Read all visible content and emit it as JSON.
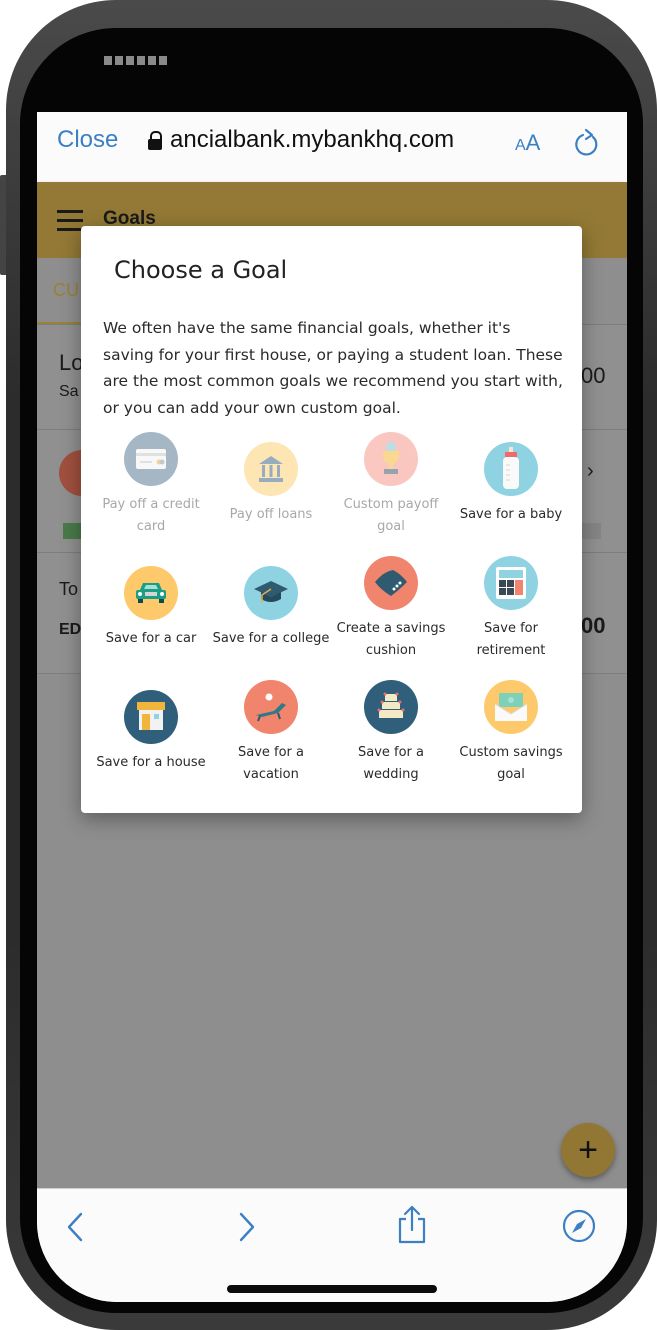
{
  "browser": {
    "close_label": "Close",
    "url": "ancialbank.mybankhq.com",
    "text_size_label": "AA"
  },
  "app_header": {
    "title": "Goals"
  },
  "background": {
    "tab_partial": "CU",
    "card1_title_partial": "Lo",
    "card1_sub_partial": "Sa",
    "card1_amount_partial": "00",
    "card3_title_partial": "To",
    "card3_sub_partial": "ED",
    "card3_amount_partial": "00"
  },
  "modal": {
    "title": "Choose a Goal",
    "description": "We often have the same financial goals, whether it's saving for your first house, or paying a student loan. These are the most common goals we recommend you start with, or you can add your own custom goal.",
    "goals": [
      {
        "label": "Pay off a credit card",
        "icon": "credit-card-icon",
        "enabled": false
      },
      {
        "label": "Pay off loans",
        "icon": "bank-building-icon",
        "enabled": false
      },
      {
        "label": "Custom payoff goal",
        "icon": "trophy-icon",
        "enabled": false
      },
      {
        "label": "Save for a baby",
        "icon": "baby-bottle-icon",
        "enabled": true
      },
      {
        "label": "Save for a car",
        "icon": "car-icon",
        "enabled": true
      },
      {
        "label": "Save for a college",
        "icon": "graduation-cap-icon",
        "enabled": true
      },
      {
        "label": "Create a savings cushion",
        "icon": "cushion-icon",
        "enabled": true
      },
      {
        "label": "Save for retirement",
        "icon": "calculator-icon",
        "enabled": true
      },
      {
        "label": "Save for a house",
        "icon": "house-icon",
        "enabled": true
      },
      {
        "label": "Save for a vacation",
        "icon": "beach-chair-icon",
        "enabled": true
      },
      {
        "label": "Save for a wedding",
        "icon": "wedding-cake-icon",
        "enabled": true
      },
      {
        "label": "Custom savings goal",
        "icon": "money-envelope-icon",
        "enabled": true
      }
    ]
  },
  "fab": {
    "label": "+"
  },
  "colors": {
    "accent": "#937935",
    "link_blue": "#3c80c4"
  }
}
